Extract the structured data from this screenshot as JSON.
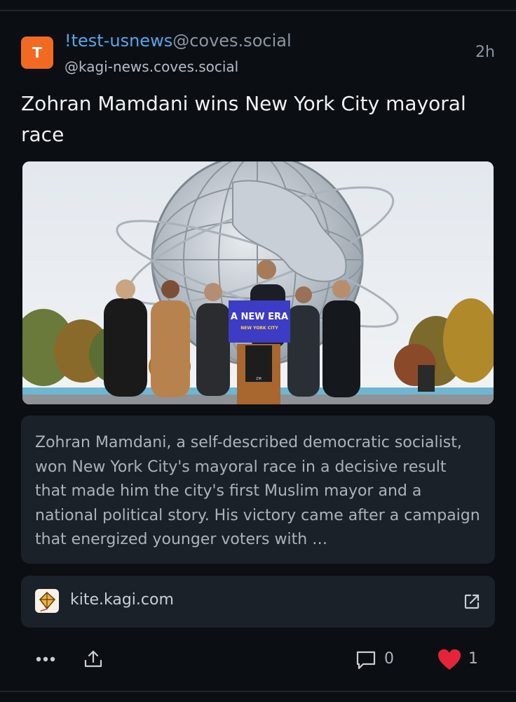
{
  "post": {
    "avatar_letter": "T",
    "community_name": "!test-usnews",
    "community_host": "@coves.social",
    "author_handle": "@kagi-news.coves.social",
    "time_ago": "2h",
    "title": "Zohran Mamdani wins New York City mayoral race",
    "image": {
      "podium_sign_line1": "A NEW ERA",
      "podium_sign_line2": "NEW YORK CITY",
      "podium_logo": "ZM"
    },
    "summary": "Zohran Mamdani, a self-described democratic socialist, won New York City's mayoral race in a decisive result that made him the city's first Muslim mayor and a national political story. His victory came after a campaign that energized younger voters with …",
    "link": {
      "domain": "kite.kagi.com",
      "icon": "kite-icon"
    },
    "actions": {
      "comment_count": "0",
      "like_count": "1"
    }
  },
  "colors": {
    "background": "#0b0f14",
    "card": "#1b2129",
    "accent_link": "#58a6e8",
    "avatar": "#f26a22",
    "like": "#e5243b"
  }
}
